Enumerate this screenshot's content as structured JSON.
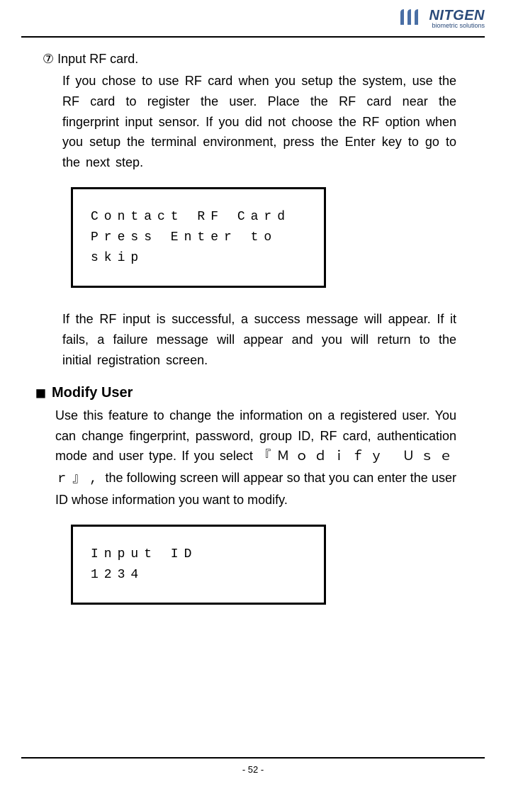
{
  "header": {
    "logo_main": "NITGEN",
    "logo_sub": "biometric solutions"
  },
  "step": {
    "number": "⑦",
    "title": "Input RF card.",
    "body1": "If you chose to use RF card when you setup the system, use the RF card to register the user. Place the RF card near the fingerprint input sensor. If you did not choose the RF option when you setup the terminal environment, press the Enter key to go to the next step.",
    "lcd_line1": "Contact RF Card",
    "lcd_line2": "Press Enter to",
    "lcd_line3": "skip",
    "body2": "If the RF input is successful, a success message will appear. If it fails, a failure message will appear and you will return to the initial registration screen."
  },
  "section": {
    "title": "Modify User",
    "body_part1": "Use this feature to change the information on a registered user. You can change fingerprint, password, group ID, RF card, authentication mode and user type. If you select",
    "body_mono": "『Ｍｏｄｉｆｙ Ｕｓｅｒ』,",
    "body_part2": " the following screen will appear so that you can enter the user ID whose information you want to modify.",
    "lcd_line1": "Input  ID",
    "lcd_line2": "1234"
  },
  "footer": {
    "page": "- 52 -"
  }
}
